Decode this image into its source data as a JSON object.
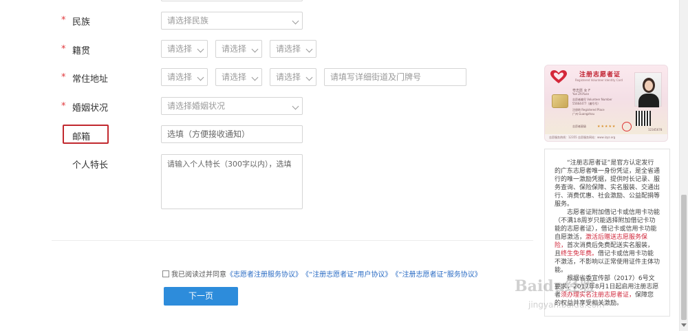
{
  "form": {
    "ethnicity": {
      "label": "民族",
      "required": "*",
      "placeholder": "请选择民族"
    },
    "native_place": {
      "label": "籍贯",
      "required": "*",
      "select1": "请选择",
      "select2": "请选择",
      "select3": "请选择"
    },
    "address": {
      "label": "常住地址",
      "required": "*",
      "select1": "请选择",
      "select2": "请选择",
      "select3": "请选择",
      "street_placeholder": "请填写详细街道及门牌号"
    },
    "marital": {
      "label": "婚姻状况",
      "required": "*",
      "placeholder": "请选择婚姻状况"
    },
    "email": {
      "label": "邮箱",
      "placeholder": "选填（方便接收通知）"
    },
    "specialty": {
      "label": "个人特长",
      "placeholder": "请输入个人特长（300字以内），选填"
    }
  },
  "agreement": {
    "prefix": "我已阅读过并同意",
    "link1": "《志愿者注册服务协议》",
    "link2": "《“注册志愿者证”用户协议》",
    "link3": "《“注册志愿者证”服务协议》"
  },
  "next_button": "下一页",
  "card": {
    "title": "注册志愿者证",
    "subtitle": "Registered Volunteer Identity Card",
    "name": "粤志愿  女 F",
    "name_en": "Yue ZhiYuan",
    "number_label": "志愿者编号 Volunteer Number",
    "number": "55664477（编号号）",
    "place_label": "注册地 Registered Place",
    "place": "广州 Guangzhou",
    "level_label": "志愿者星级",
    "stars": "★★★★★",
    "footer": "志愿服务热线：12355    志愿服务网站：www.izyz.org",
    "serial": "12345678"
  },
  "description": {
    "para1": "“注册志愿者证”是官方认定发行的广东志愿者唯一身份凭证，是全省通行的唯一激励凭据，提供时长记录、服务查询、保险保障、实名服装、交通出行、消费优惠、社会激励、公益配捐等服务。",
    "para2_a": "志愿者证附加借记卡或信用卡功能（不满18周岁只能选择附加借记卡功能的志愿者证），借记卡或信用卡功能自愿激活，",
    "para2_red1": "激活后赠送志愿服务保险，",
    "para2_b": "首次消费后免费配送实名服装，且",
    "para2_red2": "终生免年费。",
    "para2_c": "借记卡或信用卡功能不激活，不影响以正常使用证件主体功能。",
    "para3_a": "根据省委宣传部（2017）6号文要求，2017年8月1日起启用注册志愿者",
    "para3_red": "须办理实名注册志愿者证，",
    "para3_b": "保障您的权益并享受相关激励。"
  },
  "watermark": {
    "main": "Baidu经验",
    "sub": "jingyan.baidu.com"
  },
  "colors": {
    "required": "#e0363a",
    "button": "#2d8cdb",
    "link": "#2b6cc4",
    "highlight": "#c1272d"
  }
}
